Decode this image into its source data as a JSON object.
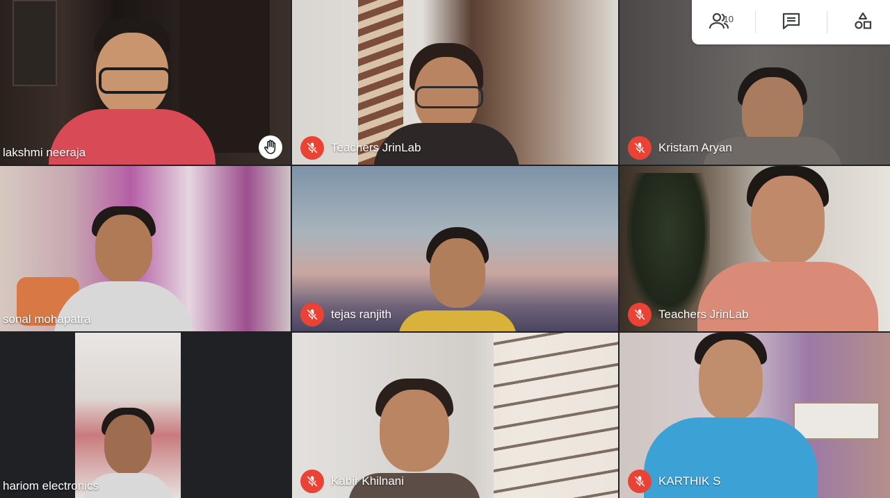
{
  "toolbar": {
    "participant_count": "10",
    "icons": [
      "people-icon",
      "chat-icon",
      "activities-icon"
    ]
  },
  "colors": {
    "mute_red": "#ea4335",
    "label_text": "#ffffff",
    "panel_bg": "#ffffff"
  },
  "participants": [
    {
      "name": "lakshmi neeraja",
      "muted": false,
      "hand_raised": true
    },
    {
      "name": "Teachers JrinLab",
      "muted": true,
      "hand_raised": false
    },
    {
      "name": "Kristam Aryan",
      "muted": true,
      "hand_raised": false
    },
    {
      "name": "sonal mohapatra",
      "muted": false,
      "hand_raised": false
    },
    {
      "name": "tejas ranjith",
      "muted": true,
      "hand_raised": false
    },
    {
      "name": "Teachers JrinLab",
      "muted": true,
      "hand_raised": false
    },
    {
      "name": "hariom electronics",
      "muted": false,
      "hand_raised": false
    },
    {
      "name": "Kabir Khilnani",
      "muted": true,
      "hand_raised": false
    },
    {
      "name": "KARTHIK S",
      "muted": true,
      "hand_raised": false
    }
  ]
}
